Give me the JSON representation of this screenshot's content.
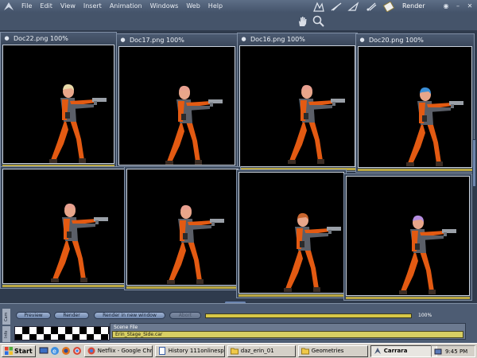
{
  "menu": {
    "items": [
      "File",
      "Edit",
      "View",
      "Insert",
      "Animation",
      "Windows",
      "Web",
      "Help"
    ],
    "room": "Render"
  },
  "documents": [
    {
      "title": "Doc22.png 100%",
      "hair_color": "#e8d9a8"
    },
    {
      "title": "Doc17.png 100%",
      "hair_color": "#e8a090"
    },
    {
      "title": "Doc16.png 100%",
      "hair_color": "#e8a090"
    },
    {
      "title": "Doc20.png 100%",
      "hair_color": "#3a8fd8"
    },
    {
      "title": "",
      "hair_color": "#e8a090"
    },
    {
      "title": "",
      "hair_color": "#e8a090"
    },
    {
      "title": "",
      "hair_color": "#c8652e"
    },
    {
      "title": "",
      "hair_color": "#b68ee0"
    }
  ],
  "render_panel": {
    "side_tabs": [
      "Cam",
      "Info"
    ],
    "buttons": {
      "preview": "Preview",
      "render": "Render",
      "render_new_window": "Render in new window",
      "abort": "Abort"
    },
    "progress": 1.0,
    "progress_label": "100%",
    "scene_file_label": "Scene File",
    "scene_file_value": "Erin_Stage_Side.car"
  },
  "taskbar": {
    "start": "Start",
    "tasks": [
      {
        "label": "Netflix - Google Chr...",
        "active": false
      },
      {
        "label": "History 111onlinesp...",
        "active": false
      },
      {
        "label": "daz_erin_01",
        "active": false
      },
      {
        "label": "Geometries",
        "active": false
      },
      {
        "label": "Carrara",
        "active": true
      }
    ],
    "clock": "9:45 PM"
  },
  "colors": {
    "suit_orange": "#e35a12",
    "suit_gray": "#5b5f68",
    "skin": "#e8a68a",
    "progress_yellow": "#d8c848"
  }
}
